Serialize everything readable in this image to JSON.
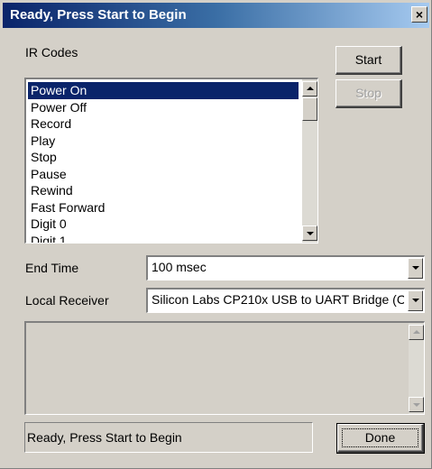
{
  "window": {
    "title": "Ready, Press Start to Begin",
    "close_label": "×"
  },
  "ir_codes": {
    "label": "IR Codes",
    "selected_index": 0,
    "items": [
      "Power On",
      "Power Off",
      "Record",
      "Play",
      "Stop",
      "Pause",
      "Rewind",
      "Fast Forward",
      "Digit 0",
      "Digit 1"
    ]
  },
  "buttons": {
    "start": "Start",
    "stop": "Stop",
    "done": "Done"
  },
  "end_time": {
    "label": "End Time",
    "value": "100 msec"
  },
  "local_receiver": {
    "label": "Local Receiver",
    "value": "Silicon Labs CP210x USB to UART Bridge (C"
  },
  "output_log": {
    "value": ""
  },
  "status": {
    "text": "Ready, Press Start to Begin"
  },
  "colors": {
    "selection": "#0a246a",
    "titlebar_start": "#0a246a",
    "titlebar_end": "#a6caf0",
    "face": "#d4d0c8"
  }
}
